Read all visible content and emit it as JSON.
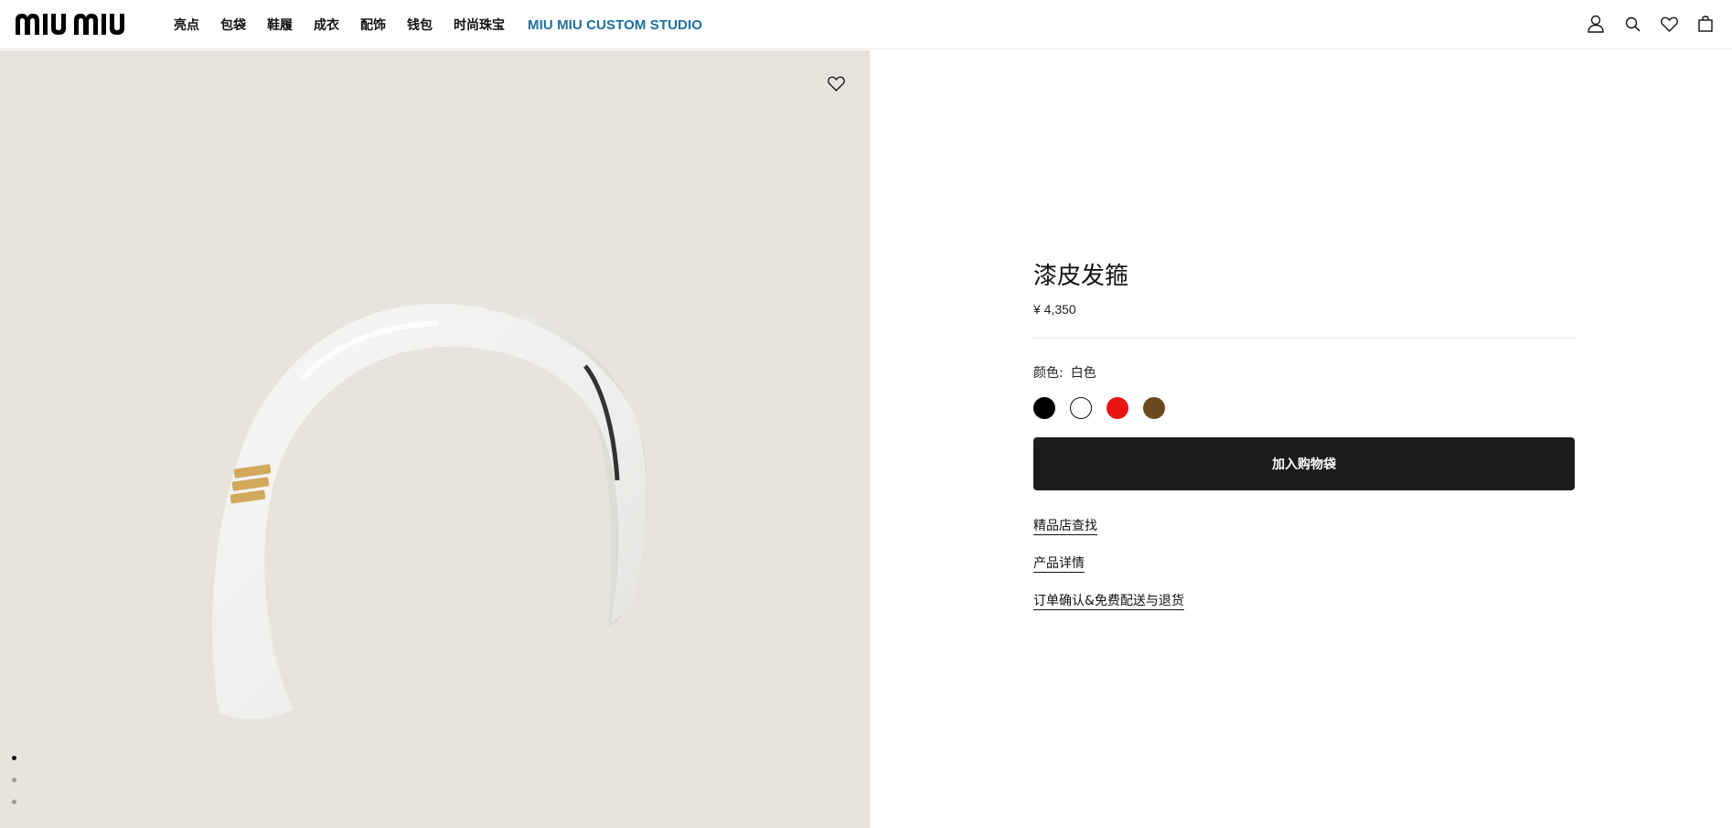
{
  "brand": {
    "logo_text": "miu miu"
  },
  "nav": {
    "items": [
      "亮点",
      "包袋",
      "鞋履",
      "成衣",
      "配饰",
      "钱包",
      "时尚珠宝"
    ],
    "studio": "MIU MIU CUSTOM STUDIO"
  },
  "header_icons": [
    "account-icon",
    "search-icon",
    "wishlist-icon",
    "bag-icon"
  ],
  "product": {
    "name": "漆皮发箍",
    "price": "¥ 4,350",
    "color_label": "颜色:",
    "color_value": "白色",
    "swatches": [
      {
        "name": "black",
        "hex": "#000000"
      },
      {
        "name": "white",
        "hex": "#ffffff",
        "selected": true
      },
      {
        "name": "red",
        "hex": "#e81414"
      },
      {
        "name": "brown",
        "hex": "#6b4a1f"
      }
    ],
    "add_to_bag": "加入购物袋",
    "links": [
      "精品店查找",
      "产品详情",
      "订单确认&免费配送与退货"
    ]
  },
  "gallery": {
    "slide_count": 3,
    "active_slide": 1
  },
  "colors": {
    "gallery_bg": "#e8e4dd",
    "button_bg": "#1b1c1e",
    "studio_link": "#1f6f9e"
  }
}
